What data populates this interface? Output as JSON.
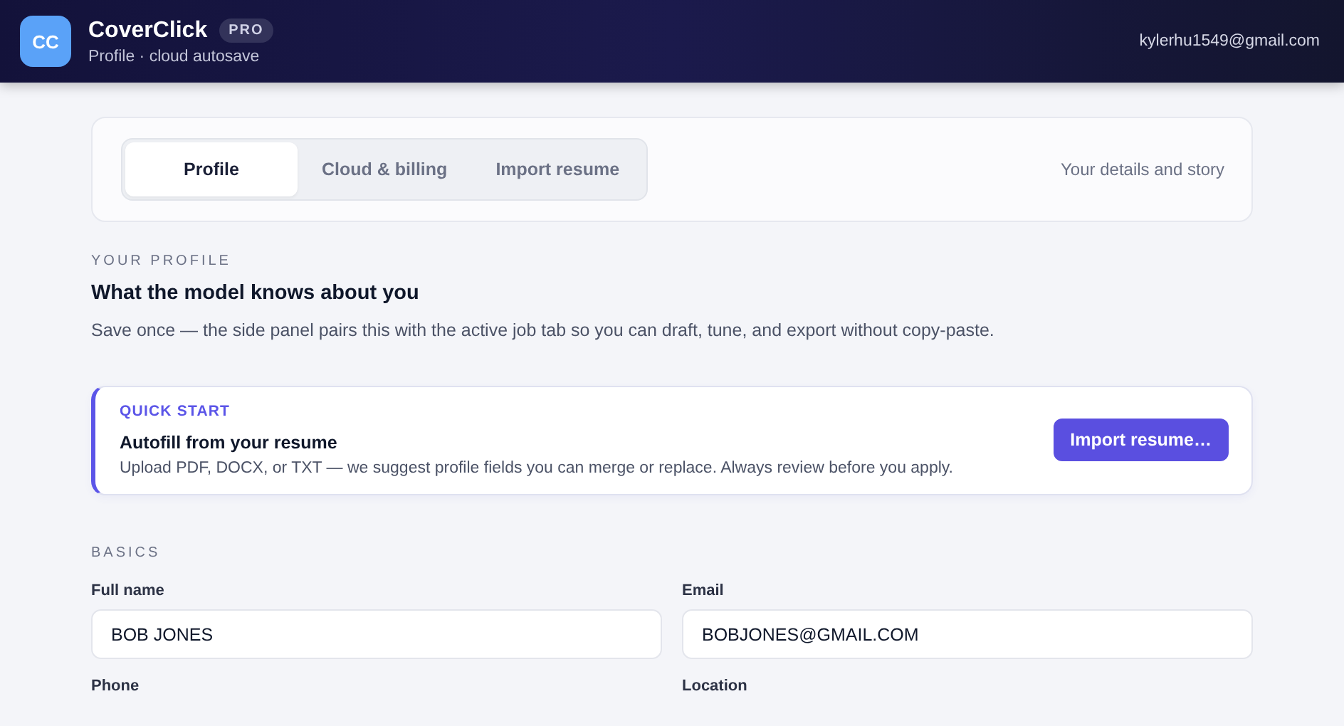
{
  "header": {
    "logo": "CC",
    "app_name": "CoverClick",
    "badge": "PRO",
    "subtitle": "Profile · cloud autosave",
    "account": "kylerhu1549@gmail.com"
  },
  "tabs": [
    {
      "label": "Profile",
      "selected": true
    },
    {
      "label": "Cloud & billing",
      "selected": false
    },
    {
      "label": "Import resume",
      "selected": false
    }
  ],
  "tabs_caption": "Your details and story",
  "intro": {
    "eyebrow": "YOUR PROFILE",
    "title": "What the model knows about you",
    "description": "Save once — the side panel pairs this with the active job tab so you can draft, tune, and export without copy-paste."
  },
  "quick_start": {
    "eyebrow": "QUICK START",
    "title": "Autofill from your resume",
    "description": "Upload PDF, DOCX, or TXT — we suggest profile fields you can merge or replace. Always review before you apply.",
    "button": "Import resume…"
  },
  "basics": {
    "heading": "BASICS",
    "fields": [
      {
        "label": "Full name",
        "value": "BOB JONES"
      },
      {
        "label": "Email",
        "value": "BOBJONES@GMAIL.COM"
      },
      {
        "label": "Phone"
      },
      {
        "label": "Location"
      }
    ]
  }
}
